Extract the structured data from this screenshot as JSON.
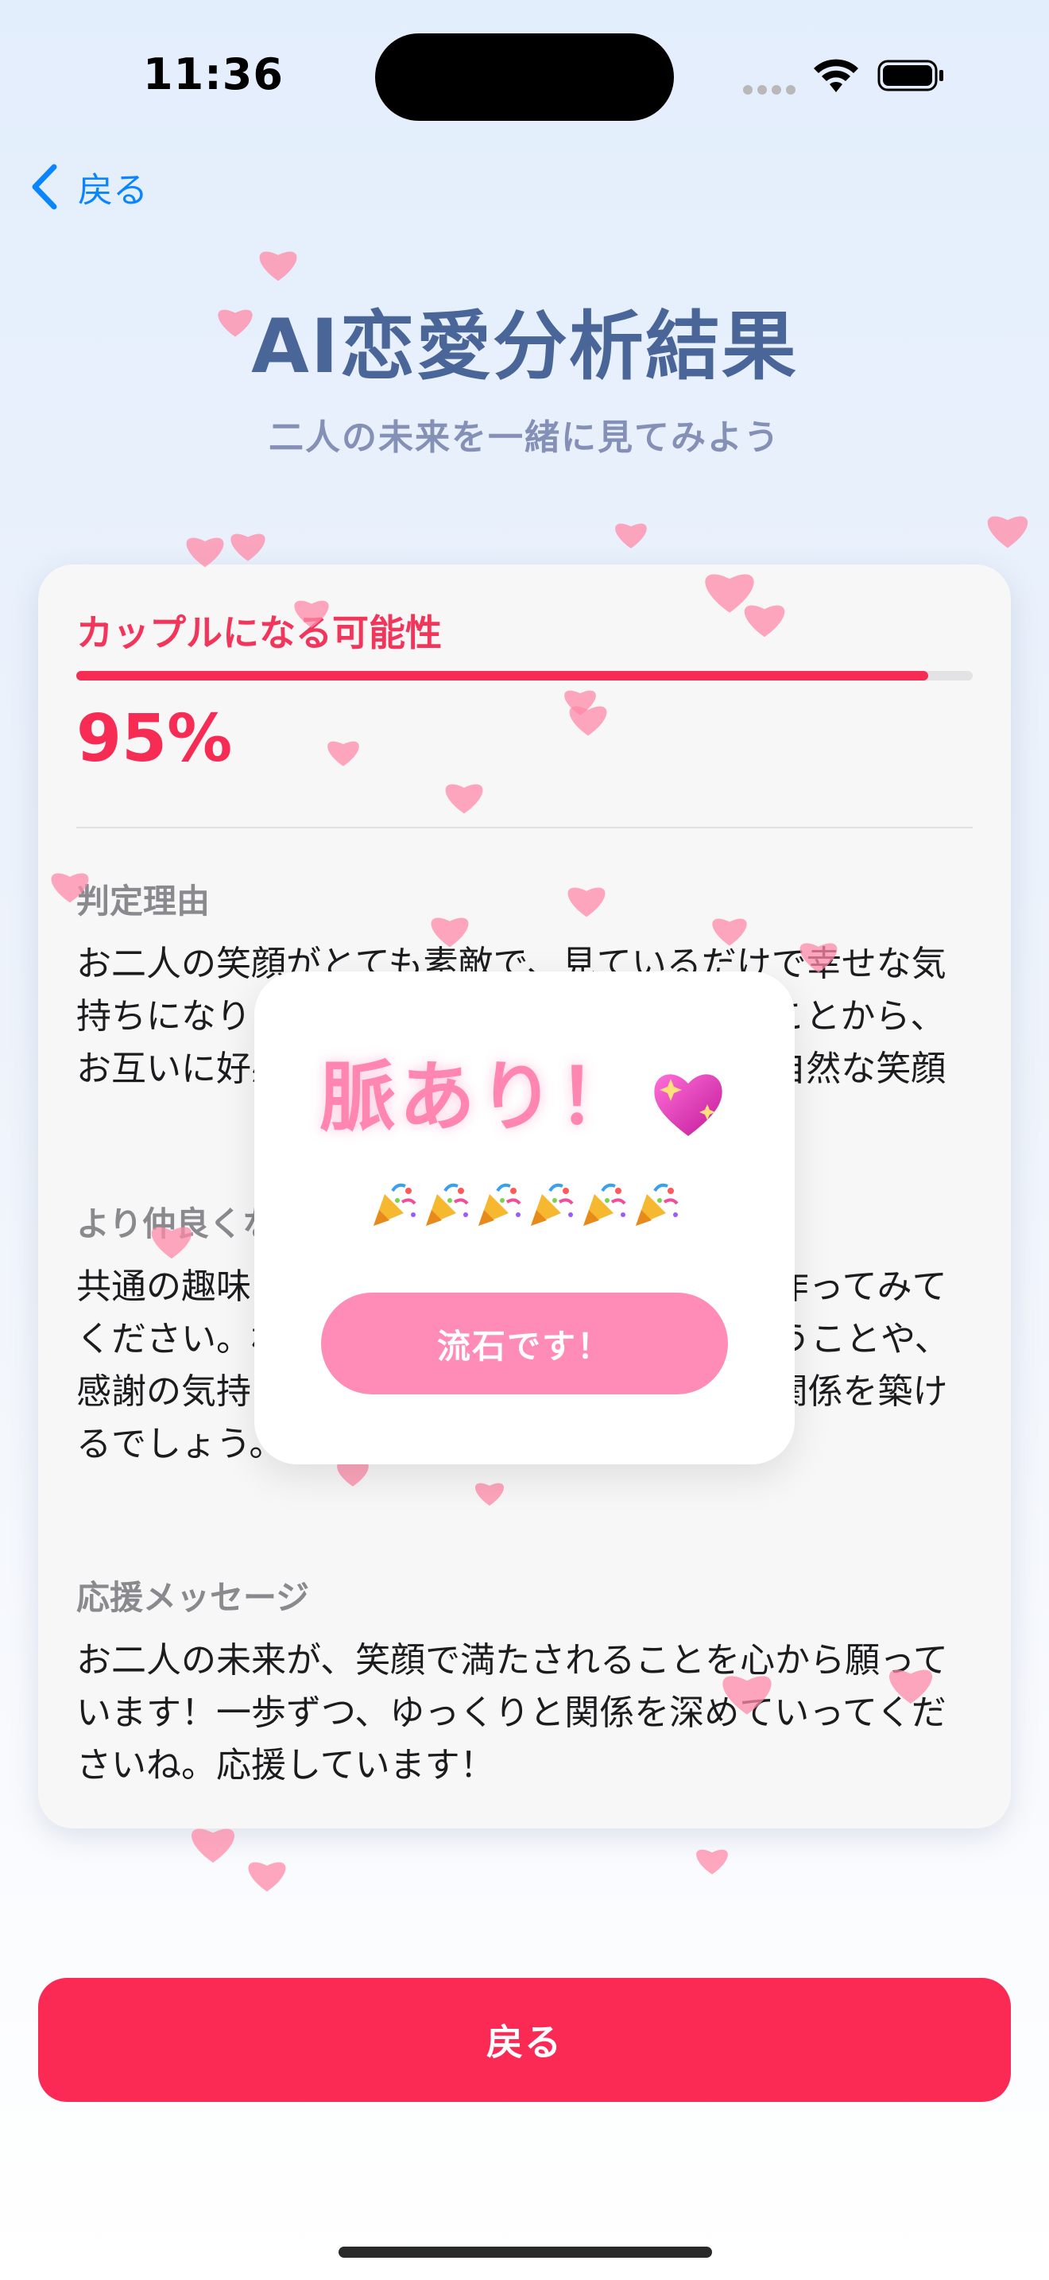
{
  "status_bar": {
    "time": "11:36"
  },
  "nav": {
    "back_label": "戻る"
  },
  "header": {
    "title": "AI恋愛分析結果",
    "subtitle": "二人の未来を一緒に見てみよう"
  },
  "result": {
    "probability_label": "カップルになる可能性",
    "probability_value": "95%",
    "probability_fraction": 0.95,
    "sections": [
      {
        "heading": "判定理由",
        "text": "お二人の笑顔がとても素敵で、見ているだけで幸せな気持ちになります。お互いに好意を持っていることから、お互いに好感を抱いているように見えます。自然な笑顔は、"
      },
      {
        "heading": "より仲良くなるために",
        "text": "共通の趣味を見つけて、一緒に楽しむ時間を作ってみてください。相手の考え方を尊重し、理解し合うことや、感謝の気持ちを言葉にすることで、より良い関係を築けるでしょう。"
      },
      {
        "heading": "応援メッセージ",
        "text": "お二人の未来が、笑顔で満たされることを心から願っています！一歩ずつ、ゆっくりと関係を深めていってくださいね。応援しています！"
      }
    ]
  },
  "dialog": {
    "title": "脈あり！",
    "title_icon": "sparkling-heart-icon",
    "party_icon": "party-popper-icon",
    "party_count": 6,
    "button_label": "流石です！"
  },
  "footer": {
    "back_button_label": "戻る"
  },
  "colors": {
    "accent": "#fa2a55",
    "dialog_accent": "#ff8cb6",
    "link": "#0a84ff",
    "title": "#4a6597"
  }
}
